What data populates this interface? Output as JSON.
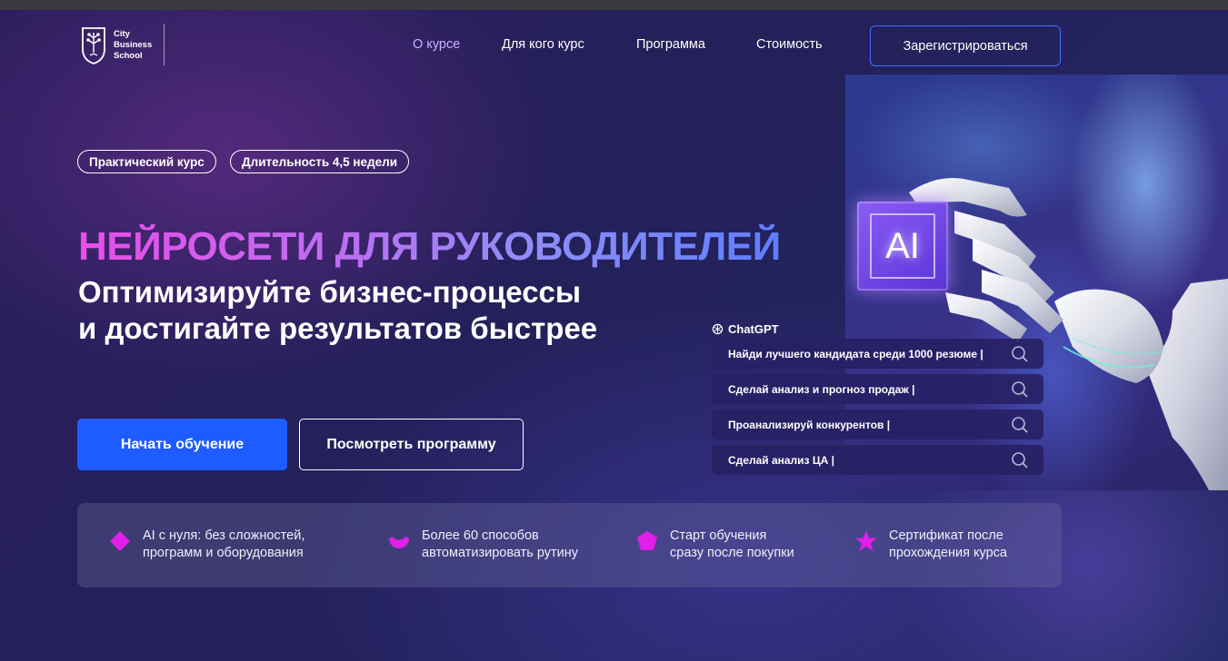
{
  "logo": {
    "line1": "City",
    "line2": "Business",
    "line3": "School"
  },
  "nav": {
    "items": [
      {
        "label": "О курсе",
        "active": true
      },
      {
        "label": "Для кого курс",
        "active": false
      },
      {
        "label": "Программа",
        "active": false
      },
      {
        "label": "Стоимость",
        "active": false
      }
    ],
    "register_label": "Зарегистрироваться"
  },
  "badges": [
    "Практический курс",
    "Длительность 4,5 недели"
  ],
  "hero": {
    "title": "НЕЙРОСЕТИ ДЛЯ РУКОВОДИТЕЛЕЙ",
    "subtitle_line1": "Оптимизируйте бизнес-процессы",
    "subtitle_line2": "и достигайте результатов быстрее",
    "chip_text": "AI"
  },
  "chatgpt": {
    "label": "ChatGPT",
    "prompts": [
      "Найди лучшего кандидата среди 1000 резюме |",
      "Сделай анализ и прогноз продаж |",
      "Проанализируй конкурентов |",
      "Сделай  анализ ЦА |"
    ]
  },
  "cta": {
    "start_label": "Начать обучение",
    "program_label": "Посмотреть программу"
  },
  "features": [
    {
      "line1": "AI с нуля: без сложностей,",
      "line2": "программ и оборудования",
      "icon": "diamond-icon"
    },
    {
      "line1": "Более 60 способов",
      "line2": "автоматизировать рутину",
      "icon": "crescent-icon"
    },
    {
      "line1": "Старт обучения",
      "line2": "сразу после покупки",
      "icon": "pentagon-icon"
    },
    {
      "line1": "Сертификат после",
      "line2": "прохождения курса",
      "icon": "star-icon"
    }
  ],
  "colors": {
    "accent_blue": "#1f5cff",
    "nav_active": "#c9b4ff",
    "feature_icon": "#e020e8"
  }
}
